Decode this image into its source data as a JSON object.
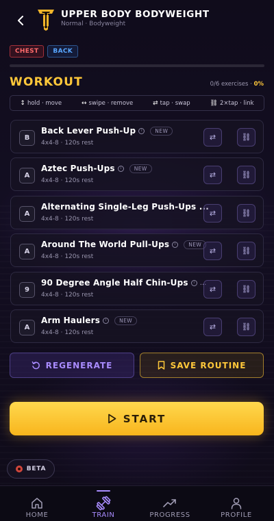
{
  "header": {
    "title": "UPPER BODY BODYWEIGHT",
    "subtitle": "Normal · Bodyweight"
  },
  "tags": [
    "CHEST",
    "BACK"
  ],
  "workout": {
    "section_title": "WORKOUT",
    "progress_count": "0/6 exercises ·",
    "progress_pct": "0%"
  },
  "hints": [
    {
      "symbol": "↕",
      "label": "hold · move"
    },
    {
      "symbol": "↔",
      "label": "swipe · remove"
    },
    {
      "symbol": "⇄",
      "label": "tap · swap"
    },
    {
      "symbol": "⛓",
      "label": "2×tap · link"
    }
  ],
  "exercises": [
    {
      "badge": "B",
      "name": "Back Lever Push-Up",
      "is_new": true,
      "new_label": "NEW",
      "meta": "4x4-8 · 120s rest"
    },
    {
      "badge": "A",
      "name": "Aztec Push-Ups",
      "is_new": true,
      "new_label": "NEW",
      "meta": "4x4-8 · 120s rest"
    },
    {
      "badge": "A",
      "name": "Alternating Single-Leg Push-Ups ...",
      "is_new": false,
      "new_label": "",
      "meta": "4x4-8 · 120s rest"
    },
    {
      "badge": "A",
      "name": "Around The World Pull-Ups",
      "is_new": true,
      "new_label": "NEW",
      "meta": "4x4-8 · 120s rest"
    },
    {
      "badge": "9",
      "name": "90 Degree Angle Half Chin-Ups",
      "is_new": true,
      "new_label": "...",
      "meta": "4x4-8 · 120s rest"
    },
    {
      "badge": "A",
      "name": "Arm Haulers",
      "is_new": true,
      "new_label": "NEW",
      "meta": "4x4-8 · 120s rest"
    }
  ],
  "actions": {
    "regenerate": "REGENERATE",
    "save_routine": "SAVE ROUTINE",
    "start": "START"
  },
  "beta_label": "BETA",
  "nav": {
    "active": "train",
    "items": [
      {
        "id": "home",
        "label": "HOME",
        "icon": "home-icon"
      },
      {
        "id": "train",
        "label": "TRAIN",
        "icon": "dumbbell-icon"
      },
      {
        "id": "progress",
        "label": "PROGRESS",
        "icon": "trend-icon"
      },
      {
        "id": "profile",
        "label": "PROFILE",
        "icon": "person-icon"
      }
    ]
  },
  "colors": {
    "accent_gold": "#ffc83a",
    "accent_purple": "#a98cff",
    "chest": "#ff6b6b",
    "back": "#58a6ff"
  }
}
